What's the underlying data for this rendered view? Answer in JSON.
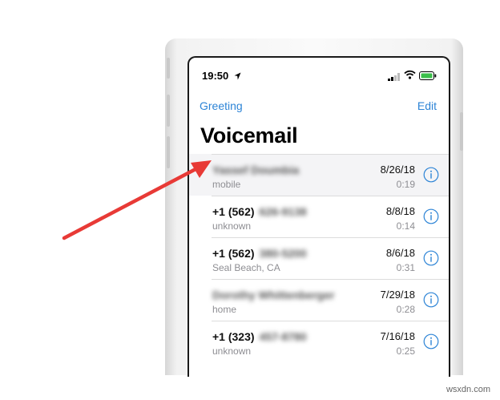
{
  "status_bar": {
    "time": "19:50",
    "location_icon": "location-arrow-icon",
    "signal_icon": "cellular-signal-icon",
    "wifi_icon": "wifi-icon",
    "battery_icon": "battery-icon"
  },
  "nav": {
    "greeting_label": "Greeting",
    "edit_label": "Edit"
  },
  "title": "Voicemail",
  "accent_color": "#2d84d6",
  "arrow_color": "#e83a36",
  "voicemails": [
    {
      "caller": "Yassef Doumbia",
      "label": "mobile",
      "date": "8/26/18",
      "duration": "0:19"
    },
    {
      "caller": "+1 (562)",
      "caller_blurred": "626-9138",
      "label": "unknown",
      "date": "8/8/18",
      "duration": "0:14"
    },
    {
      "caller": "+1 (562)",
      "caller_blurred": "380-5200",
      "label": "Seal Beach, CA",
      "date": "8/6/18",
      "duration": "0:31"
    },
    {
      "caller": "Dorothy Whittenberger",
      "label": "home",
      "date": "7/29/18",
      "duration": "0:28"
    },
    {
      "caller": "+1 (323)",
      "caller_blurred": "457-8780",
      "label": "unknown",
      "date": "7/16/18",
      "duration": "0:25"
    }
  ],
  "watermark": "wsxdn.com"
}
